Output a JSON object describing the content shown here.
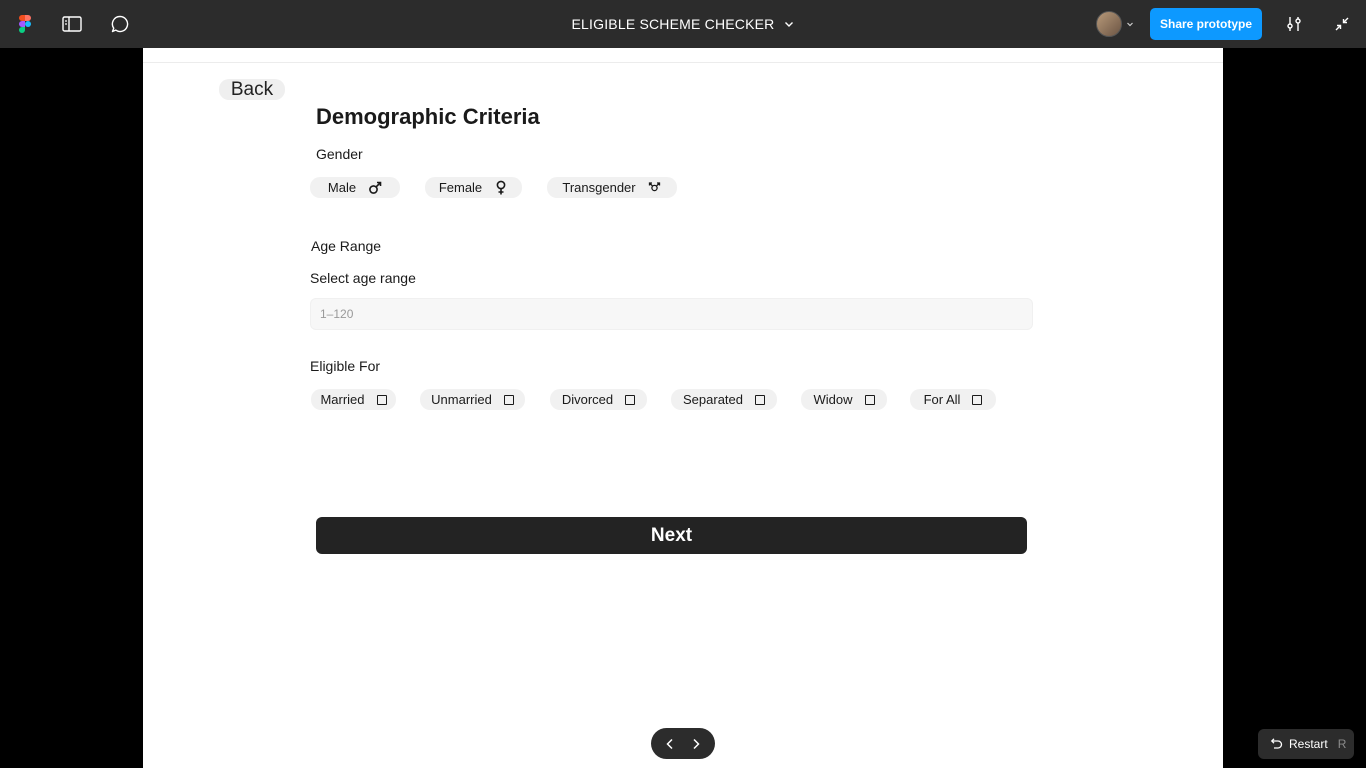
{
  "topbar": {
    "project_title": "ELIGIBLE SCHEME CHECKER",
    "share_label": "Share prototype",
    "icons": [
      "figma-logo-icon",
      "panel-toggle-icon",
      "comment-icon",
      "chevron-down-icon",
      "avatar",
      "sliders-icon",
      "collapse-icon"
    ],
    "accent": "#0d99ff"
  },
  "page": {
    "back_label": "Back",
    "title": "Demographic Criteria",
    "gender": {
      "label": "Gender",
      "options": [
        {
          "label": "Male",
          "icon": "male-symbol-icon"
        },
        {
          "label": "Female",
          "icon": "female-symbol-icon"
        },
        {
          "label": "Transgender",
          "icon": "transgender-symbol-icon"
        }
      ]
    },
    "age": {
      "section_label": "Age Range",
      "field_label": "Select age range",
      "placeholder": "1–120"
    },
    "eligible": {
      "label": "Eligible For",
      "options": [
        {
          "label": "Married",
          "checked": false
        },
        {
          "label": "Unmarried",
          "checked": false
        },
        {
          "label": "Divorced",
          "checked": false
        },
        {
          "label": "Separated",
          "checked": false
        },
        {
          "label": "Widow",
          "checked": false
        },
        {
          "label": "For All",
          "checked": false
        }
      ]
    },
    "next_label": "Next"
  },
  "footer": {
    "restart_label": "Restart",
    "restart_key": "R"
  }
}
